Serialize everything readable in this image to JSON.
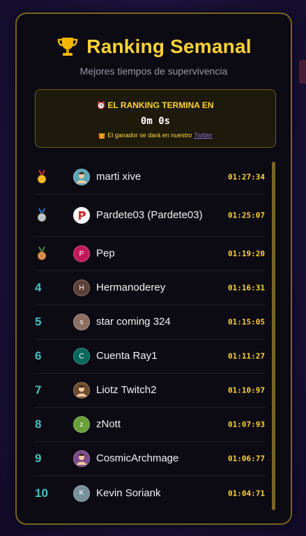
{
  "header": {
    "title": "Ranking Semanal",
    "subtitle": "Mejores tiempos de supervivencia"
  },
  "timer": {
    "heading": "EL RANKING TERMINA EN",
    "value": "0m 0s",
    "note_prefix": "El ganador se dará en nuestro",
    "note_link": "Twitter"
  },
  "ranking": [
    {
      "rank": "1",
      "medal": "gold",
      "name": "marti xive",
      "time": "01:27:34",
      "avatar_letter": "",
      "avatar_color": "#5aa6b8"
    },
    {
      "rank": "2",
      "medal": "silver",
      "name": "Pardete03 (Pardete03)",
      "time": "01:25:07",
      "avatar_letter": "",
      "avatar_color": "#ffffff"
    },
    {
      "rank": "3",
      "medal": "bronze",
      "name": "Pep",
      "time": "01:19:20",
      "avatar_letter": "P",
      "avatar_color": "#c2185b"
    },
    {
      "rank": "4",
      "medal": "",
      "name": "Hermanoderey",
      "time": "01:16:31",
      "avatar_letter": "H",
      "avatar_color": "#5d4037"
    },
    {
      "rank": "5",
      "medal": "",
      "name": "star coming 324",
      "time": "01:15:05",
      "avatar_letter": "s",
      "avatar_color": "#8d6e63"
    },
    {
      "rank": "6",
      "medal": "",
      "name": "Cuenta Ray1",
      "time": "01:11:27",
      "avatar_letter": "C",
      "avatar_color": "#00695c"
    },
    {
      "rank": "7",
      "medal": "",
      "name": "Liotz Twitch2",
      "time": "01:10:97",
      "avatar_letter": "",
      "avatar_color": "#6d4c2f"
    },
    {
      "rank": "8",
      "medal": "",
      "name": "zNott",
      "time": "01:07:93",
      "avatar_letter": "z",
      "avatar_color": "#689f38"
    },
    {
      "rank": "9",
      "medal": "",
      "name": "CosmicArchmage",
      "time": "01:06:77",
      "avatar_letter": "",
      "avatar_color": "#7b4a8a"
    },
    {
      "rank": "10",
      "medal": "",
      "name": "Kevin Soriank",
      "time": "01:04:71",
      "avatar_letter": "K",
      "avatar_color": "#78909c"
    }
  ],
  "colors": {
    "accent": "#ffd335",
    "rank_number": "#3fc4c4",
    "card_border": "#7b6420",
    "background": "#1a1238"
  }
}
